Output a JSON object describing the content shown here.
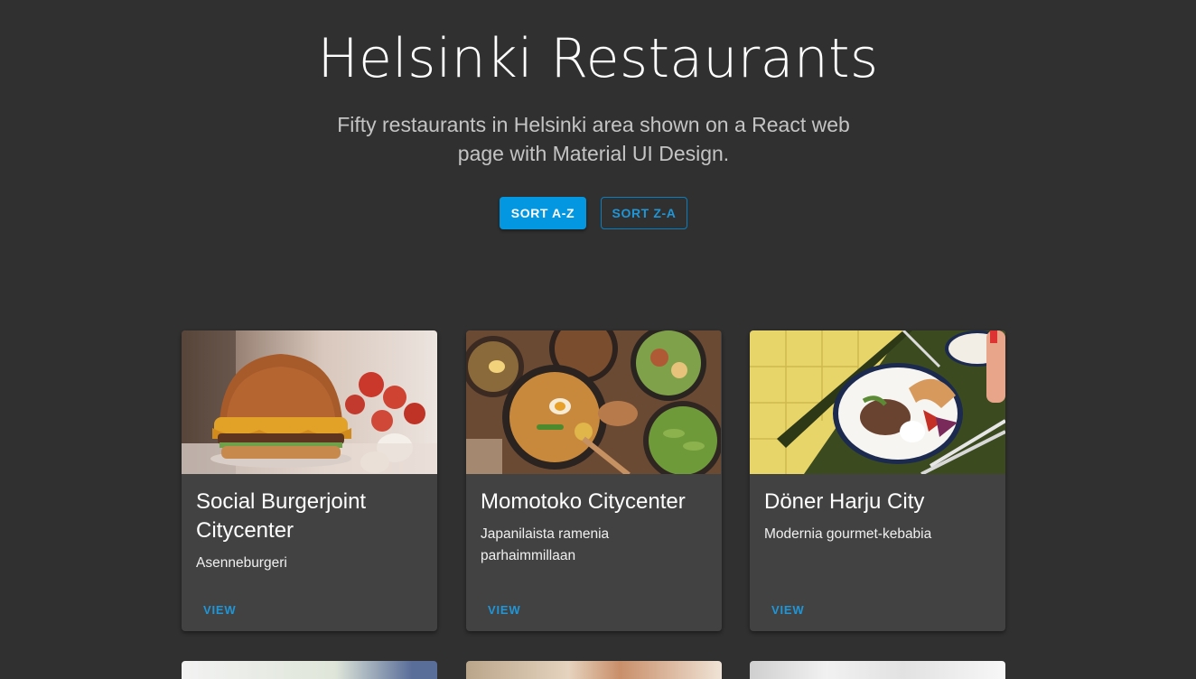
{
  "header": {
    "title": "Helsinki Restaurants",
    "subtitle": "Fifty restaurants in Helsinki area shown on a React web page with Material UI Design."
  },
  "toolbar": {
    "sort_az_label": "SORT A-Z",
    "sort_za_label": "SORT Z-A"
  },
  "colors": {
    "background": "#303030",
    "card": "#424242",
    "accent": "#0497e1"
  },
  "cards": [
    {
      "title": "Social Burgerjoint Citycenter",
      "description": "Asenneburgeri",
      "action": "VIEW",
      "image": "burger-photo"
    },
    {
      "title": "Momotoko Citycenter",
      "description": "Japanilaista ramenia parhaimmillaan",
      "action": "VIEW",
      "image": "ramen-bowls-photo"
    },
    {
      "title": "Döner Harju City",
      "description": "Modernia gourmet-kebabia",
      "action": "VIEW",
      "image": "kebab-plate-photo"
    }
  ]
}
